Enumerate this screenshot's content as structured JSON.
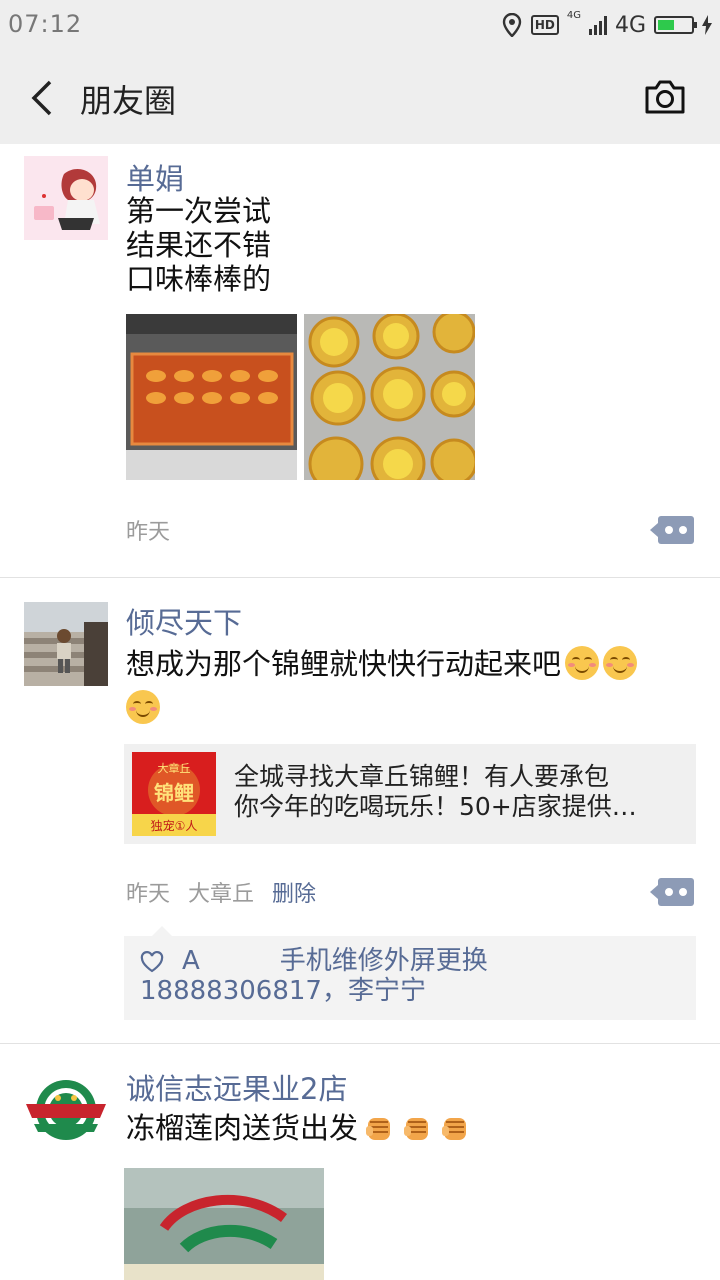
{
  "status": {
    "time": "07:12",
    "hd": "HD",
    "net_small": "4G",
    "net": "4G"
  },
  "nav": {
    "title": "朋友圈"
  },
  "posts": [
    {
      "name": "单娟",
      "lines": "第一次尝试\n结果还不错\n口味棒棒的",
      "time": "昨天"
    },
    {
      "name": "倾尽天下",
      "text": "想成为那个锦鲤就快快行动起来吧",
      "link": {
        "line1": "全城寻找大章丘锦鲤！有人要承包",
        "line2": "你今年的吃喝玩乐！50+店家提供…",
        "thumb_top": "大章丘",
        "thumb_main": "锦鲤",
        "thumb_bottom": "独宠①人"
      },
      "time": "昨天",
      "location": "大章丘",
      "delete": "删除",
      "likes": {
        "a": "A",
        "b": "手机维修外屏更换",
        "c": "18888306817，李宁宁"
      }
    },
    {
      "name": "诚信志远果业2店",
      "text": "冻榴莲肉送货出发"
    }
  ],
  "colors": {
    "link_blue": "#576b95",
    "gray_bg": "#eeeeee"
  }
}
